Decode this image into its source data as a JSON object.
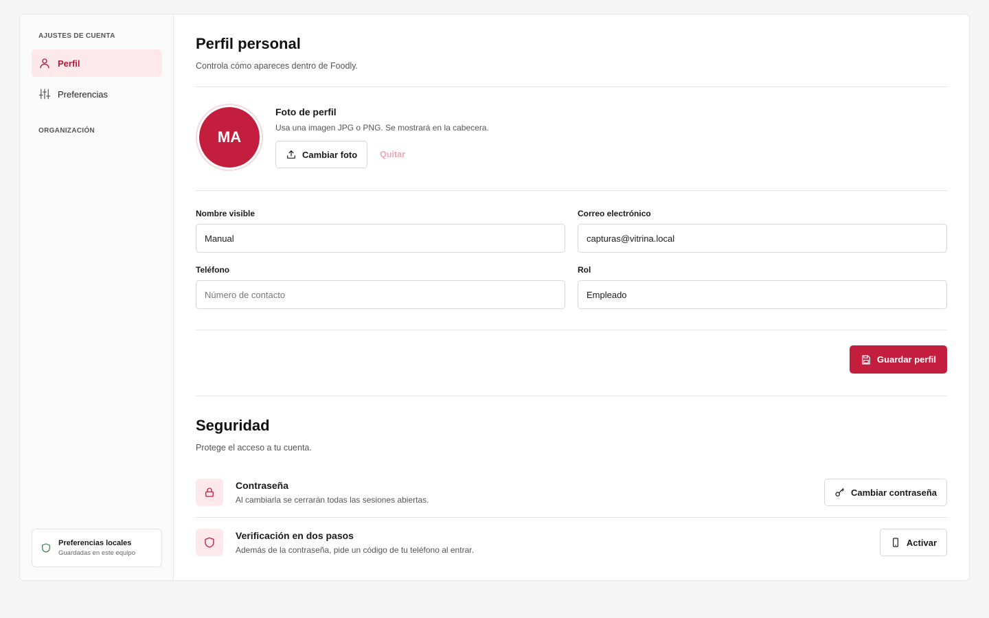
{
  "sidebar": {
    "account_heading": "AJUSTES DE CUENTA",
    "items": [
      {
        "label": "Perfil",
        "icon": "user-icon",
        "active": true
      },
      {
        "label": "Preferencias",
        "icon": "sliders-icon",
        "active": false
      }
    ],
    "org_heading": "ORGANIZACIÓN",
    "local_box": {
      "title": "Preferencias locales",
      "subtitle": "Guardadas en este equipo",
      "icon": "shield-icon"
    }
  },
  "profile": {
    "title": "Perfil personal",
    "subtitle": "Controla cómo apareces dentro de Foodly.",
    "photo": {
      "initials": "MA",
      "title": "Foto de perfil",
      "description": "Usa una imagen JPG o PNG. Se mostrará en la cabecera.",
      "change_label": "Cambiar foto",
      "remove_label": "Quitar"
    },
    "fields": {
      "name": {
        "label": "Nombre visible",
        "value": "Manual",
        "placeholder": ""
      },
      "email": {
        "label": "Correo electrónico",
        "value": "capturas@vitrina.local",
        "placeholder": ""
      },
      "phone": {
        "label": "Teléfono",
        "value": "",
        "placeholder": "Número de contacto"
      },
      "role": {
        "label": "Rol",
        "value": "Empleado",
        "placeholder": ""
      }
    },
    "save_label": "Guardar perfil"
  },
  "security": {
    "title": "Seguridad",
    "subtitle": "Protege el acceso a tu cuenta.",
    "items": [
      {
        "title": "Contraseña",
        "description": "Al cambiarla se cerrarán todas las sesiones abiertas.",
        "button": "Cambiar contraseña",
        "icon": "lock-icon",
        "button_icon": "key-icon"
      },
      {
        "title": "Verificación en dos pasos",
        "description": "Además de la contraseña, pide un código de tu teléfono al entrar.",
        "button": "Activar",
        "icon": "shield-icon",
        "button_icon": "phone-icon"
      }
    ]
  },
  "colors": {
    "accent": "#c41e3f",
    "accent_soft": "#fde8ec",
    "success": "#2e7d4f"
  }
}
